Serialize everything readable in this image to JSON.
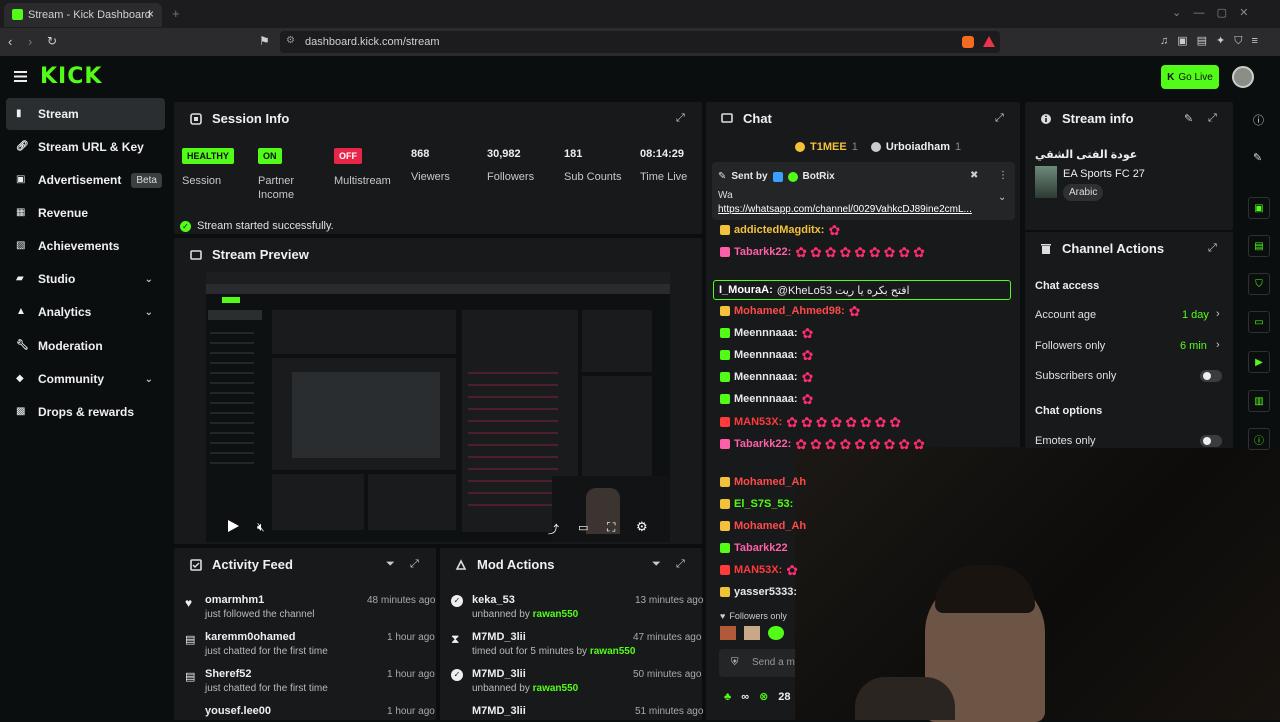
{
  "browser": {
    "tab_title": "Stream - Kick Dashboard",
    "url": "dashboard.kick.com/stream"
  },
  "header": {
    "logo": "KICK",
    "go_live": "Go Live"
  },
  "sidebar": {
    "items": [
      {
        "label": "Stream",
        "icon": "stream-icon"
      },
      {
        "label": "Stream URL & Key",
        "icon": "link-icon"
      },
      {
        "label": "Advertisement",
        "icon": "ad-icon",
        "badge": "Beta"
      },
      {
        "label": "Revenue",
        "icon": "revenue-icon"
      },
      {
        "label": "Achievements",
        "icon": "trophy-icon"
      },
      {
        "label": "Studio",
        "icon": "studio-icon"
      },
      {
        "label": "Analytics",
        "icon": "analytics-icon"
      },
      {
        "label": "Moderation",
        "icon": "wrench-icon"
      },
      {
        "label": "Community",
        "icon": "community-icon"
      },
      {
        "label": "Drops & rewards",
        "icon": "gift-icon"
      }
    ]
  },
  "session": {
    "title": "Session Info",
    "stats": [
      {
        "value": "HEALTHY",
        "label": "Session"
      },
      {
        "value": "ON",
        "label": "Partner Income"
      },
      {
        "value": "OFF",
        "label": "Multistream"
      },
      {
        "value": "868",
        "label": "Viewers"
      },
      {
        "value": "30,982",
        "label": "Followers"
      },
      {
        "value": "181",
        "label": "Sub Counts"
      },
      {
        "value": "08:14:29",
        "label": "Time Live"
      }
    ],
    "status": "Stream started successfully."
  },
  "preview": {
    "title": "Stream Preview"
  },
  "activity": {
    "title": "Activity Feed",
    "items": [
      {
        "name": "omarmhm1",
        "sub": "just followed the channel",
        "time": "48 minutes ago"
      },
      {
        "name": "karemm0ohamed",
        "sub": "just chatted for the first time",
        "time": "1 hour ago"
      },
      {
        "name": "Sheref52",
        "sub": "just chatted for the first time",
        "time": "1 hour ago"
      },
      {
        "name": "yousef.lee00",
        "sub": "",
        "time": "1 hour ago"
      }
    ]
  },
  "mod": {
    "title": "Mod Actions",
    "items": [
      {
        "name": "keka_53",
        "sub": "unbanned by",
        "by": "rawan550",
        "time": "13 minutes ago"
      },
      {
        "name": "M7MD_3lii",
        "sub": "timed out for 5 minutes by",
        "by": "rawan550",
        "time": "47 minutes ago"
      },
      {
        "name": "M7MD_3lii",
        "sub": "unbanned by",
        "by": "rawan550",
        "time": "50 minutes ago"
      },
      {
        "name": "M7MD_3lii",
        "sub": "",
        "by": "",
        "time": "51 minutes ago"
      }
    ]
  },
  "chat": {
    "title": "Chat",
    "top_users": [
      "T1MEE",
      "1",
      "Urboiadham",
      "1"
    ],
    "pinned": {
      "sent_by": "Sent by",
      "sender": "BotRix",
      "text": "Wa",
      "link": "https://whatsapp.com/channel/0029VahkcDJ89ine2cmL..."
    },
    "messages": [
      {
        "user": "addictedMagditx:",
        "color": "#f3c13a",
        "emotes": 1
      },
      {
        "user": "Tabarkk22:",
        "color": "#ff5fa8",
        "emotes": 9
      },
      {
        "user": "I_MouraA:",
        "color": "#ffffff",
        "text": "@KheLo53 افتح بكره يا ريت",
        "highlight": true
      },
      {
        "user": "Mohamed_Ahmed98:",
        "color": "#ff4a4a",
        "emotes": 1
      },
      {
        "user": "Meennnaaa:",
        "color": "#e8e8e8",
        "emotes": 1
      },
      {
        "user": "Meennnaaa:",
        "color": "#e8e8e8",
        "emotes": 1
      },
      {
        "user": "Meennnaaa:",
        "color": "#e8e8e8",
        "emotes": 1
      },
      {
        "user": "Meennnaaa:",
        "color": "#e8e8e8",
        "emotes": 1
      },
      {
        "user": "MAN53X:",
        "color": "#ff3b3b",
        "emotes": 8
      },
      {
        "user": "Tabarkk22:",
        "color": "#ff5fa8",
        "emotes": 9
      },
      {
        "user": "Mohamed_Ah",
        "color": "#ff4a4a",
        "emotes": 0
      },
      {
        "user": "El_S7S_53:",
        "color": "#53fc18",
        "emotes": 0
      },
      {
        "user": "Mohamed_Ah",
        "color": "#ff4a4a",
        "emotes": 0
      },
      {
        "user": "Tabarkk22",
        "color": "#ff5fa8",
        "emotes": 0
      },
      {
        "user": "MAN53X:",
        "color": "#ff3b3b",
        "emotes": 1
      },
      {
        "user": "yasser5333:",
        "color": "#e8e8e8",
        "emotes": 0
      }
    ],
    "followers_only": "Followers only",
    "send_placeholder": "Send a me",
    "bottom_count": "28"
  },
  "stream_info": {
    "title": "Stream info",
    "stream_title": "عودة الفتى الشقي",
    "category": "EA Sports FC 27",
    "language": "Arabic"
  },
  "channel_actions": {
    "title": "Channel Actions",
    "chat_access": "Chat access",
    "rows": [
      {
        "label": "Account age",
        "value": "1 day"
      },
      {
        "label": "Followers only",
        "value": "6 min"
      },
      {
        "label": "Subscribers only",
        "value": ""
      }
    ],
    "chat_options": "Chat options",
    "emotes_only": "Emotes only"
  }
}
